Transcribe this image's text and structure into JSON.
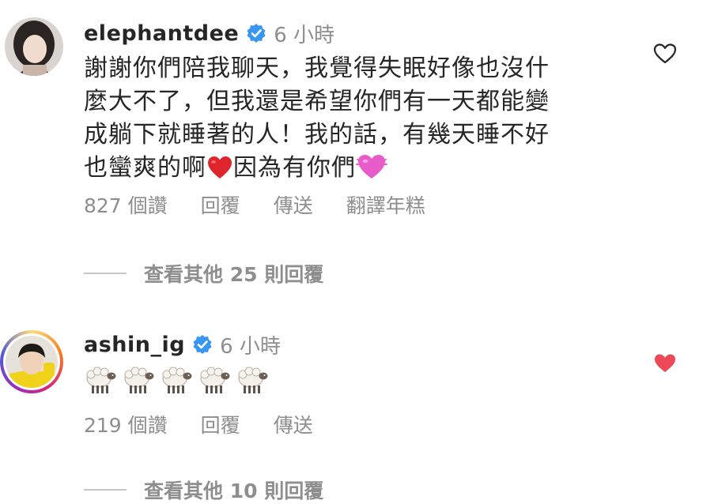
{
  "comments": [
    {
      "username": "elephantdee",
      "time": "6 小時",
      "lines": [
        "謝謝你們陪我聊天，我覺得失眠好像也沒什",
        "麼大不了，但我還是希望你們有一天都能變",
        "成躺下就睡著的人！我的話，有幾天睡不好",
        "也蠻爽的啊",
        "因為有你們"
      ],
      "likes": "827 個讚",
      "reply": "回覆",
      "send": "傳送",
      "translate": "翻譯年糕",
      "liked": false,
      "view_replies": "查看其他 25 則回覆"
    },
    {
      "username": "ashin_ig",
      "time": "6 小時",
      "sheep_count": 5,
      "likes": "219 個讚",
      "reply": "回覆",
      "send": "傳送",
      "liked": true,
      "view_replies": "查看其他 10 則回覆"
    }
  ],
  "colors": {
    "text": "#262626",
    "secondary": "#8e8e8e",
    "verified": "#3897f0",
    "liked_heart": "#ed4956",
    "red_heart_emoji": "#e0242b",
    "pink_heart_emoji": "#e85cc9"
  },
  "icons": [
    "verified-badge-icon",
    "heart-outline-icon",
    "heart-filled-icon",
    "red-heart-emoji",
    "pink-heart-emoji",
    "sheep-emoji"
  ]
}
